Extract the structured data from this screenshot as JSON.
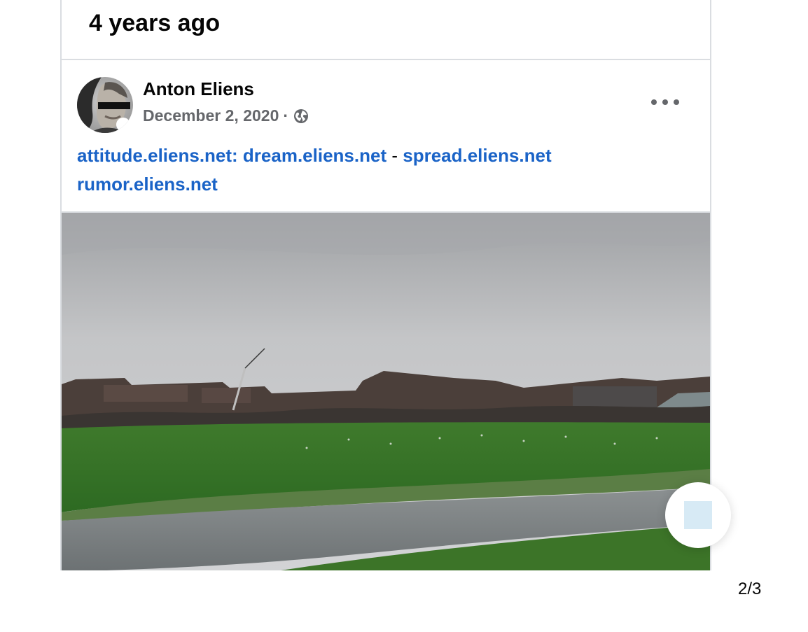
{
  "memory": {
    "title": "4 years ago"
  },
  "post": {
    "author": "Anton Eliens",
    "date": "December 2, 2020",
    "separator": "·",
    "privacy_icon": "globe-icon",
    "more_icon": "more-horizontal-icon",
    "text": {
      "link1": "attitude.eliens.net: dream.eliens.net",
      "dash": " - ",
      "link2": "spread.eliens.net",
      "link3": "rumor.eliens.net"
    },
    "photo_icon": "landscape-photo"
  },
  "fab": {
    "icon": "stop-square-icon"
  },
  "pager": {
    "label": "2/3"
  },
  "colors": {
    "link": "#1a63c7",
    "border": "#dadde1",
    "meta": "#65676b",
    "fab_square": "#d7eaf5"
  }
}
